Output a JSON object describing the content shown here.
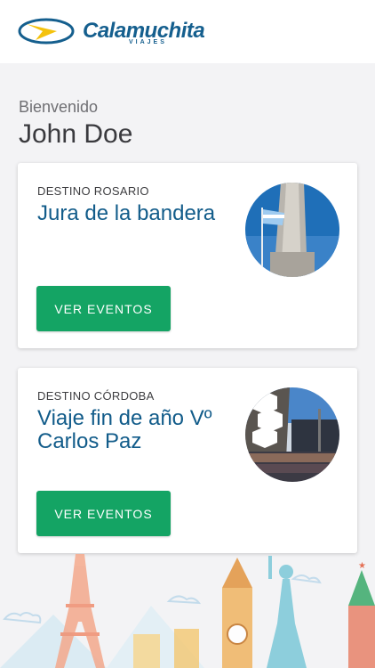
{
  "brand": {
    "name": "Calamuchita",
    "subtitle": "VIAJES",
    "colors": {
      "primary": "#155f8e",
      "accent": "#f4c20d",
      "button": "#14a464"
    }
  },
  "welcome": {
    "greeting": "Bienvenido",
    "user_name": "John Doe"
  },
  "cards": [
    {
      "destino": "DESTINO ROSARIO",
      "title": "Jura de la bandera",
      "button_label": "VER EVENTOS",
      "image_icon": "monument-flag-photo"
    },
    {
      "destino": "DESTINO CÓRDOBA",
      "title": "Viaje fin de año Vº Carlos Paz",
      "button_label": "VER EVENTOS",
      "image_icon": "group-photo"
    }
  ]
}
